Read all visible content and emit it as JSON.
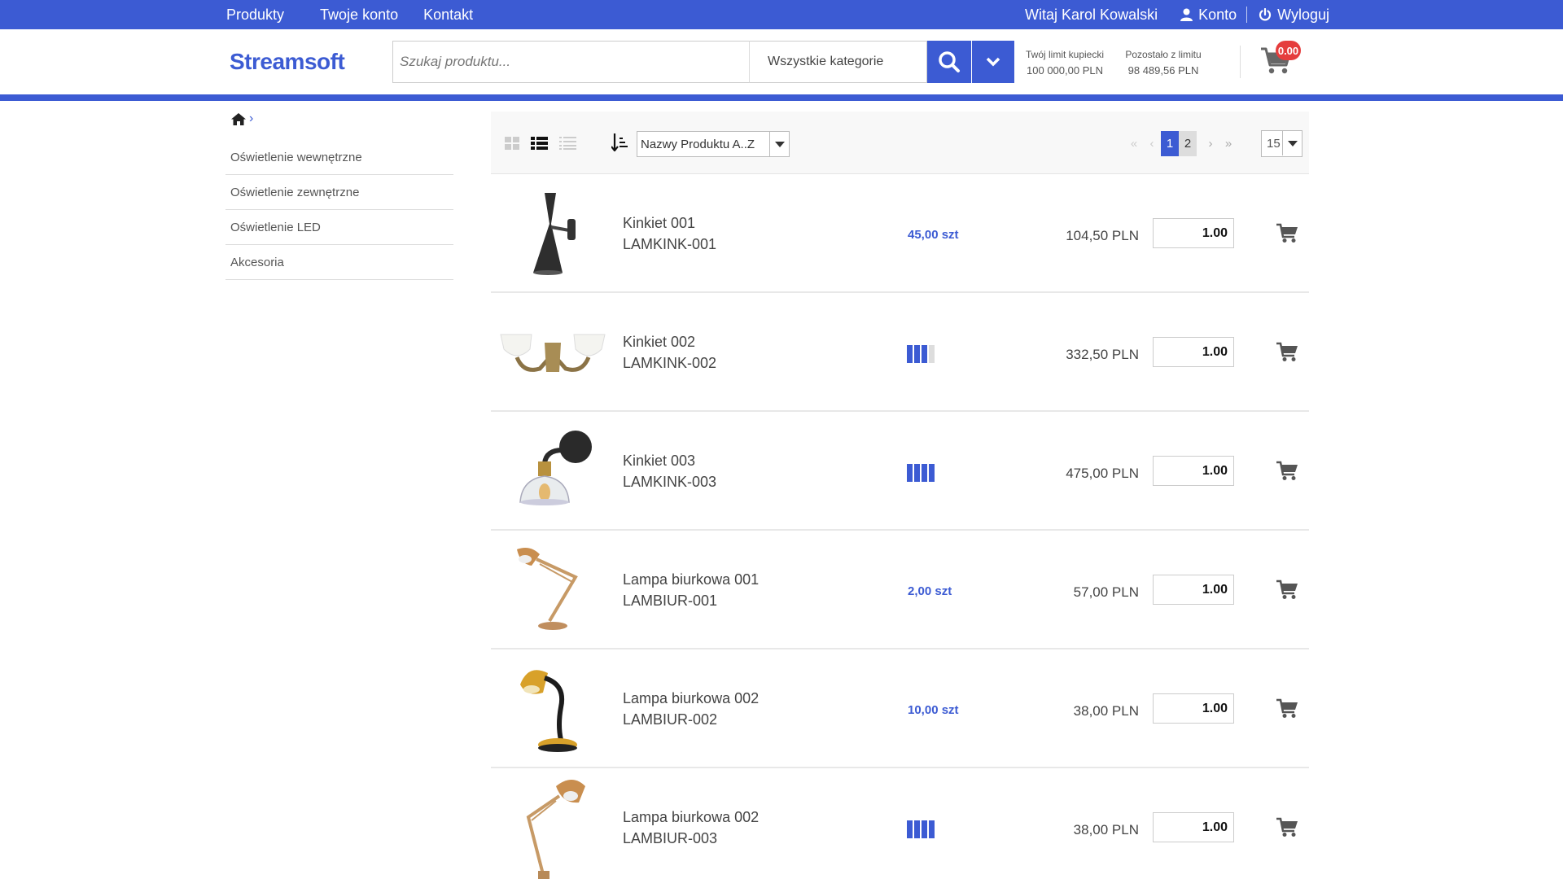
{
  "topbar": {
    "nav": [
      "Produkty",
      "Twoje konto",
      "Kontakt"
    ],
    "welcome": "Witaj Karol Kowalski",
    "account": "Konto",
    "logout": "Wyloguj"
  },
  "header": {
    "logo": "Streamsoft",
    "search_placeholder": "Szukaj produktu...",
    "category": "Wszystkie kategorie",
    "limit_label": "Twój limit kupiecki",
    "limit_value": "100 000,00 PLN",
    "remaining_label": "Pozostało z limitu",
    "remaining_value": "98 489,56 PLN",
    "cart_badge": "0.00"
  },
  "sidebar": {
    "categories": [
      "Oświetlenie wewnętrzne",
      "Oświetlenie zewnętrzne",
      "Oświetlenie LED",
      "Akcesoria"
    ]
  },
  "toolbar": {
    "sort": "Nazwy Produktu A..Z",
    "pages": [
      "1",
      "2"
    ],
    "current_page": "1",
    "per_page": "15"
  },
  "products": [
    {
      "name": "Kinkiet 001",
      "code": "LAMKINK-001",
      "stock": "45,00 szt",
      "stock_level": null,
      "price": "104,50 PLN",
      "qty": "1.00"
    },
    {
      "name": "Kinkiet 002",
      "code": "LAMKINK-002",
      "stock": "",
      "stock_level": 3,
      "price": "332,50 PLN",
      "qty": "1.00"
    },
    {
      "name": "Kinkiet 003",
      "code": "LAMKINK-003",
      "stock": "",
      "stock_level": 4,
      "price": "475,00 PLN",
      "qty": "1.00"
    },
    {
      "name": "Lampa biurkowa 001",
      "code": "LAMBIUR-001",
      "stock": "2,00 szt",
      "stock_level": null,
      "price": "57,00 PLN",
      "qty": "1.00"
    },
    {
      "name": "Lampa biurkowa 002",
      "code": "LAMBIUR-002",
      "stock": "10,00 szt",
      "stock_level": null,
      "price": "38,00 PLN",
      "qty": "1.00"
    },
    {
      "name": "Lampa biurkowa 002",
      "code": "LAMBIUR-003",
      "stock": "",
      "stock_level": 4,
      "price": "38,00 PLN",
      "qty": "1.00"
    }
  ],
  "colors": {
    "brand": "#3c5bd3",
    "badge": "#e53d3d"
  }
}
